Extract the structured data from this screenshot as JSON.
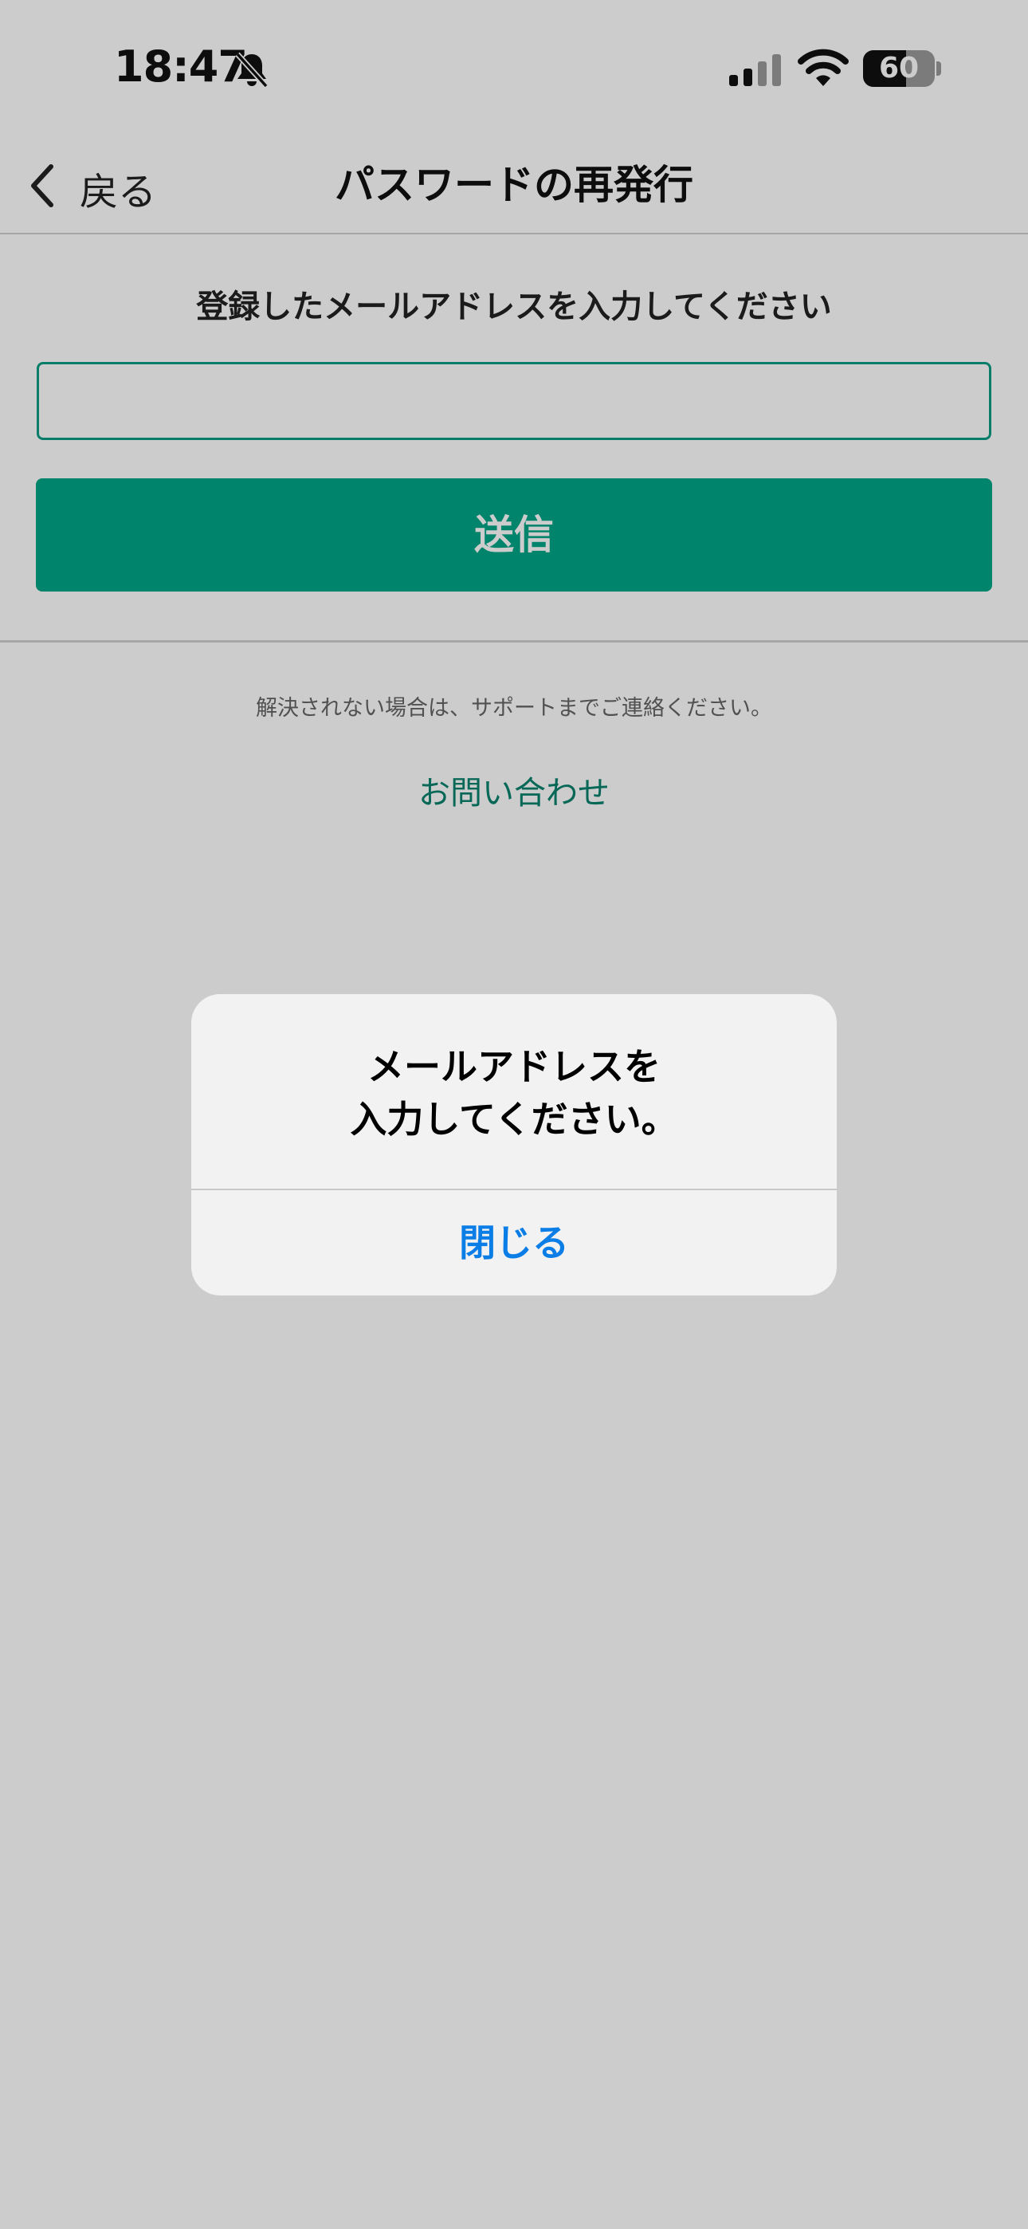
{
  "status_bar": {
    "time": "18:47",
    "silent_icon": "bell-slash-icon",
    "signal_icon": "cellular-signal-icon",
    "wifi_icon": "wifi-icon",
    "battery_level": "60",
    "battery_fraction": 0.6
  },
  "nav": {
    "back_label": "戻る",
    "back_icon": "chevron-left-icon",
    "title": "パスワードの再発行"
  },
  "form": {
    "instruction": "登録したメールアドレスを入力してください",
    "email_value": "",
    "email_placeholder": "",
    "submit_label": "送信",
    "support_note": "解決されない場合は、サポートまでご連絡ください。",
    "contact_link": "お問い合わせ"
  },
  "alert": {
    "message_line1": "メールアドレスを",
    "message_line2": "入力してください。",
    "close_label": "閉じる"
  },
  "colors": {
    "accent_green": "#00a586",
    "link_green": "#09836e",
    "alert_button_blue": "#0a7de6",
    "overlay": "rgba(0,0,0,0.2)"
  }
}
